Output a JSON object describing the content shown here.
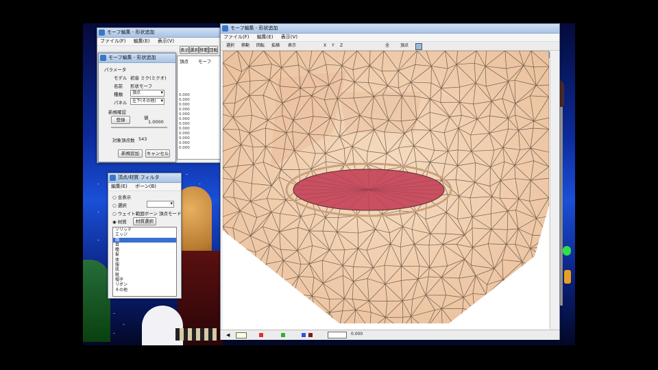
{
  "desktop": {
    "thumb_window": {
      "title": "モーフ編集 - 形状追加",
      "menus": [
        "ファイル(F)",
        "編集(E)",
        "表示(V)"
      ],
      "tabs": [
        "表示",
        "選択",
        "移動",
        "回転"
      ]
    },
    "morph_dialog": {
      "title": "モーフ編集 - 形状追加",
      "group_label": "パラメータ",
      "model_label": "モデル",
      "model_value": "初音 ミク(ミクオ)",
      "name_label": "名前",
      "name_value": "形状モーフ",
      "type_label": "種類",
      "type_value": "頂点",
      "panel_label": "パネル",
      "panel_value": "左下(その他)",
      "section_label": "新規確認",
      "confirm_button": "登録",
      "weight_label": "値",
      "weight_value": "1.0000",
      "vertex_count_label": "対象頂点数",
      "vertex_count_value": "543",
      "apply_button": "新規追加",
      "cancel_button": "キャンセル"
    },
    "background_table": {
      "headers": [
        "頂点",
        "モーフ"
      ],
      "rows": [
        "0.000",
        "0.000",
        "0.000",
        "0.000",
        "0.000",
        "0.000",
        "0.000",
        "0.000",
        "0.000",
        "0.000",
        "0.000",
        "0.000"
      ]
    },
    "vertex_panel": {
      "title": "頂点/材質 フィルタ",
      "menus": [
        "編集(E)",
        "ボーン(B)"
      ],
      "radio_all": "全表示",
      "radio_select": "選択",
      "radio_weight": "ウェイト範囲ボーン",
      "radio_weight_value": "頂点モード",
      "radio_material": "材質",
      "material_button": "材質選択",
      "items": [
        "ソリッド",
        "エッジ",
        "顔",
        "目",
        "瞳",
        "髪",
        "体",
        "服",
        "肌",
        "靴",
        "帽子",
        "リボン",
        "その他"
      ]
    },
    "editor": {
      "title": "モーフ編集 - 形状追加",
      "menus": [
        "ファイル(F)",
        "編集(E)",
        "表示(V)"
      ],
      "toolbar_items": [
        "選択",
        "移動",
        "回転",
        "拡縮",
        "表示",
        "X",
        "Y",
        "Z",
        "全",
        "頂点"
      ],
      "status_value": "0.000"
    }
  },
  "colors": {
    "skin": "#f0d0b0",
    "lip": "#c85060",
    "mesh_line": "#5a4a3a",
    "desktop_bg": "#0c2a9a"
  }
}
